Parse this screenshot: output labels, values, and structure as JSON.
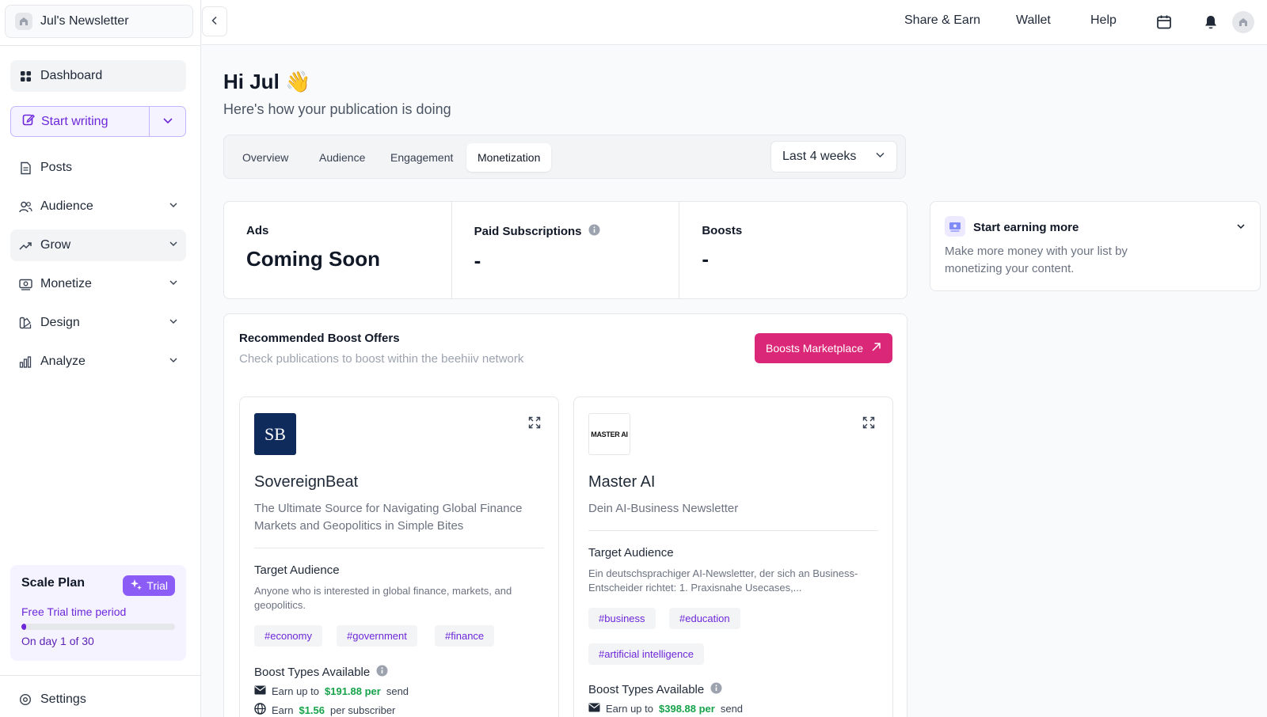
{
  "sidebar": {
    "publication": "Jul's Newsletter",
    "dashboard": "Dashboard",
    "start_writing": "Start writing",
    "items": [
      {
        "label": "Posts"
      },
      {
        "label": "Audience"
      },
      {
        "label": "Grow"
      },
      {
        "label": "Monetize"
      },
      {
        "label": "Design"
      },
      {
        "label": "Analyze"
      }
    ],
    "plan": {
      "title": "Scale Plan",
      "badge": "Trial",
      "subtitle": "Free Trial time period",
      "progress": 0.033,
      "day": "On day 1 of 30"
    },
    "settings": "Settings"
  },
  "topbar": {
    "links": [
      "Share & Earn",
      "Wallet",
      "Help"
    ]
  },
  "main": {
    "greeting": "Hi Jul 👋",
    "subtitle": "Here's how your publication is doing",
    "tabs": [
      "Overview",
      "Audience",
      "Engagement",
      "Monetization"
    ],
    "active_tab": "Monetization",
    "range": "Last 4 weeks",
    "stats": [
      {
        "label": "Ads",
        "value": "Coming Soon"
      },
      {
        "label": "Paid Subscriptions",
        "value": "-"
      },
      {
        "label": "Boosts",
        "value": "-"
      }
    ],
    "earn": {
      "title": "Start earning more",
      "desc": "Make more money with your list by monetizing your content."
    },
    "boost": {
      "title": "Recommended Boost Offers",
      "subtitle": "Check publications to boost within the beehiiv network",
      "button": "Boosts Marketplace",
      "offers": [
        {
          "logo_text": "SB",
          "name": "SovereignBeat",
          "desc": "The Ultimate Source for Navigating Global Finance Markets and Geopolitics in Simple Bites",
          "ta_label": "Target Audience",
          "ta_text": "Anyone who is interested in global finance, markets, and geopolitics.",
          "tags": [
            "#economy",
            "#government",
            "#finance"
          ],
          "bt_label": "Boost Types Available",
          "lines": [
            {
              "pre": "Earn up to",
              "money": "$191.88 per",
              "post": "send"
            },
            {
              "pre": "Earn",
              "money": "$1.56",
              "post": "per subscriber"
            }
          ]
        },
        {
          "logo_text": "MASTER AI",
          "name": "Master AI",
          "desc": "Dein AI-Business Newsletter",
          "ta_label": "Target Audience",
          "ta_text": "Ein deutschsprachiger AI-Newsletter, der sich an Business-Entscheider richtet: 1. Praxisnahe Usecases,...",
          "tags": [
            "#business",
            "#education",
            "#artificial intelligence"
          ],
          "bt_label": "Boost Types Available",
          "lines": [
            {
              "pre": "Earn up to",
              "money": "$398.88 per",
              "post": "send"
            }
          ]
        }
      ]
    }
  },
  "colors": {
    "accent": "#6d28d9",
    "boost_button": "#db2777",
    "money": "#16a34a"
  }
}
